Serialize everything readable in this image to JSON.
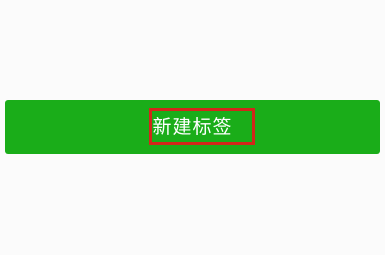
{
  "new_tag_button": {
    "label": "新建标签"
  },
  "colors": {
    "page_background": "#fbfbfb",
    "button_green": "#1aad19",
    "highlight_red": "#d2271a",
    "label_text": "#ffffff"
  }
}
